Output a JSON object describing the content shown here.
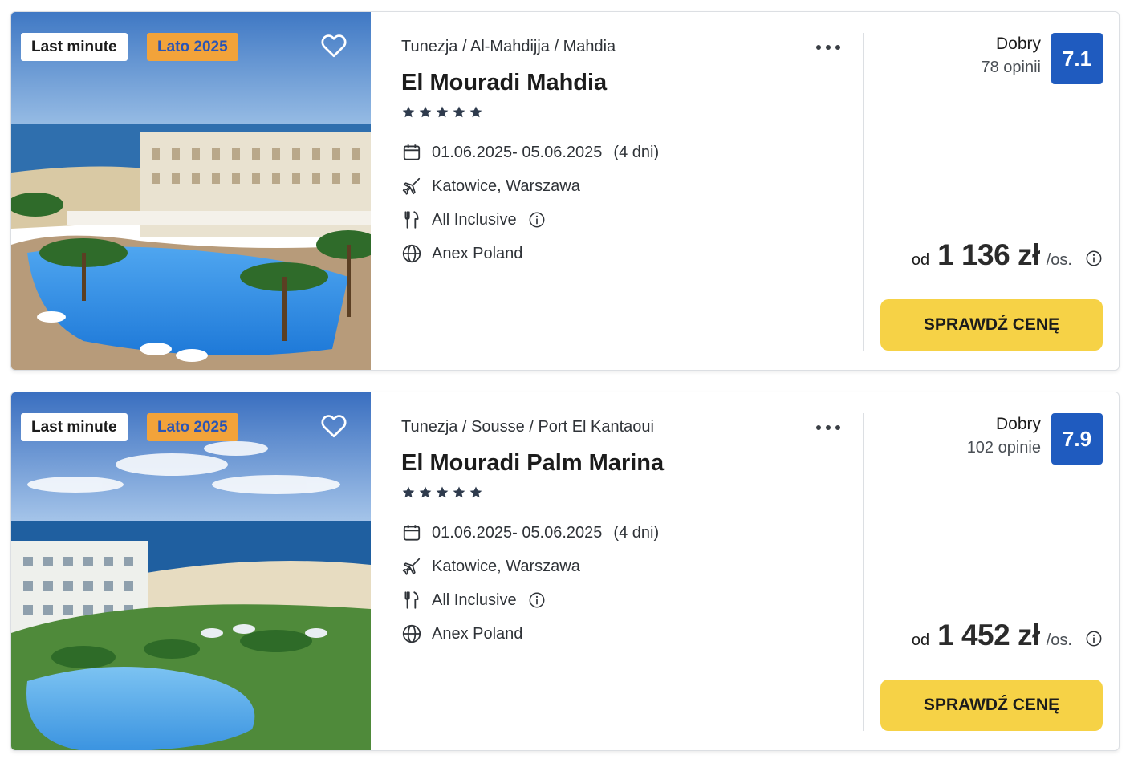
{
  "colors": {
    "accent_yellow": "#f6d246",
    "rating_blue": "#1f5bbf",
    "season_badge_bg": "#f2a33a",
    "season_badge_text": "#2a55b5"
  },
  "offers": [
    {
      "badge_primary": "Last minute",
      "badge_secondary": "Lato 2025",
      "breadcrumb": "Tunezja / Al-Mahdijja / Mahdia",
      "title": "El Mouradi Mahdia",
      "stars": 5,
      "dates": "01.06.2025- 05.06.2025",
      "duration": "(4 dni)",
      "departure": "Katowice, Warszawa",
      "board": "All Inclusive",
      "operator": "Anex Poland",
      "rating_label": "Dobry",
      "rating_count": "78 opinii",
      "rating_score": "7.1",
      "price_prefix": "od",
      "price": "1 136 zł",
      "price_unit": "/os.",
      "cta": "SPRAWDŹ CENĘ",
      "icons": [
        "heart-icon",
        "calendar-icon",
        "plane-icon",
        "cutlery-icon",
        "info-icon",
        "globe-icon"
      ]
    },
    {
      "badge_primary": "Last minute",
      "badge_secondary": "Lato 2025",
      "breadcrumb": "Tunezja / Sousse / Port El Kantaoui",
      "title": "El Mouradi Palm Marina",
      "stars": 5,
      "dates": "01.06.2025- 05.06.2025",
      "duration": "(4 dni)",
      "departure": "Katowice, Warszawa",
      "board": "All Inclusive",
      "operator": "Anex Poland",
      "rating_label": "Dobry",
      "rating_count": "102 opinie",
      "rating_score": "7.9",
      "price_prefix": "od",
      "price": "1 452 zł",
      "price_unit": "/os.",
      "cta": "SPRAWDŹ CENĘ",
      "icons": [
        "heart-icon",
        "calendar-icon",
        "plane-icon",
        "cutlery-icon",
        "info-icon",
        "globe-icon"
      ]
    }
  ]
}
